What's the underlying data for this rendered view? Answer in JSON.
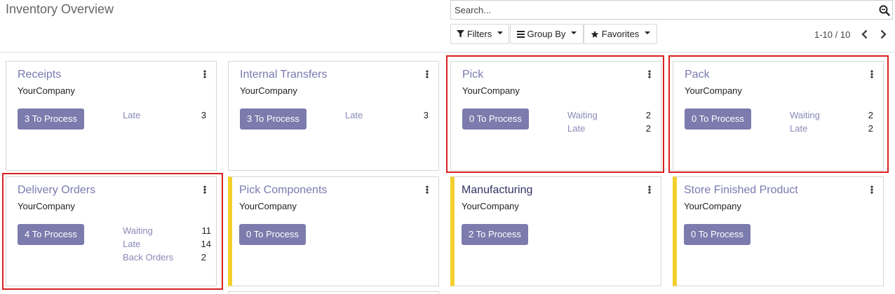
{
  "header": {
    "title": "Inventory Overview",
    "search_placeholder": "Search...",
    "filters_label": "Filters",
    "group_by_label": "Group By",
    "favorites_label": "Favorites",
    "pager": "1-10 / 10"
  },
  "cards": [
    {
      "name": "Receipts",
      "company": "YourCompany",
      "process_label": "3 To Process",
      "stats": [
        {
          "label": "Late",
          "value": "3"
        }
      ]
    },
    {
      "name": "Internal Transfers",
      "company": "YourCompany",
      "process_label": "3 To Process",
      "stats": [
        {
          "label": "Late",
          "value": "3"
        }
      ]
    },
    {
      "name": "Pick",
      "company": "YourCompany",
      "process_label": "0 To Process",
      "stats": [
        {
          "label": "Waiting",
          "value": "2"
        },
        {
          "label": "Late",
          "value": "2"
        }
      ]
    },
    {
      "name": "Pack",
      "company": "YourCompany",
      "process_label": "0 To Process",
      "stats": [
        {
          "label": "Waiting",
          "value": "2"
        },
        {
          "label": "Late",
          "value": "2"
        }
      ]
    },
    {
      "name": "Delivery Orders",
      "company": "YourCompany",
      "process_label": "4 To Process",
      "stats": [
        {
          "label": "Waiting",
          "value": "11"
        },
        {
          "label": "Late",
          "value": "14"
        },
        {
          "label": "Back Orders",
          "value": "2"
        }
      ]
    },
    {
      "name": "Pick Components",
      "company": "YourCompany",
      "process_label": "0 To Process",
      "stats": []
    },
    {
      "name": "Manufacturing",
      "company": "YourCompany",
      "process_label": "2 To Process",
      "stats": []
    },
    {
      "name": "Store Finished Product",
      "company": "YourCompany",
      "process_label": "0 To Process",
      "stats": []
    }
  ],
  "colors": {
    "accent": "#7c7bad",
    "link": "#8a89b8",
    "flag": "#f4cf2c",
    "highlight": "#d92020"
  }
}
